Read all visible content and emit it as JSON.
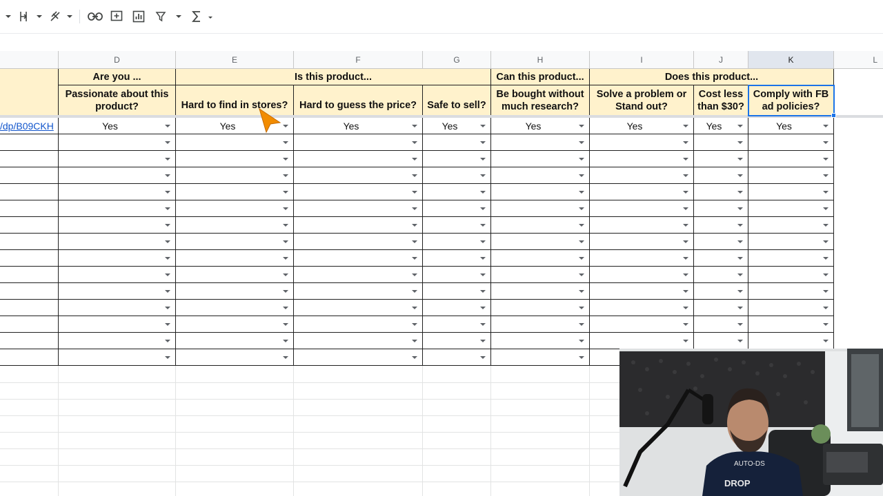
{
  "toolbar": {
    "icons": [
      "chevron-down-icon",
      "text-wrap-icon",
      "text-rotation-icon",
      "insert-link-icon",
      "insert-comment-icon",
      "insert-chart-icon",
      "filter-icon",
      "functions-icon"
    ]
  },
  "columns": {
    "D": "D",
    "E": "E",
    "F": "F",
    "G": "G",
    "H": "H",
    "I": "I",
    "J": "J",
    "K": "K",
    "L": "L"
  },
  "header_groups": {
    "are_you": "Are you ...",
    "is_this_product": "Is this product...",
    "can_this_product": "Can this product...",
    "does_this_product": "Does this product..."
  },
  "questions": {
    "D": "Passionate about this product?",
    "E": "Hard to find in stores?",
    "F": "Hard to guess the price?",
    "G": "Safe to sell?",
    "H": "Be bought without much research?",
    "I": "Solve a problem or Stand out?",
    "J": "Cost less than $30?",
    "K": "Comply with FB ad policies?"
  },
  "row1": {
    "link": "/dp/B09CKH",
    "D": "Yes",
    "E": "Yes",
    "F": "Yes",
    "G": "Yes",
    "H": "Yes",
    "I": "Yes",
    "J": "Yes",
    "K": "Yes"
  },
  "colors": {
    "header_fill": "#fff2cc",
    "selection": "#1a73e8",
    "link": "#1155cc",
    "cursor": "#f28c00"
  }
}
